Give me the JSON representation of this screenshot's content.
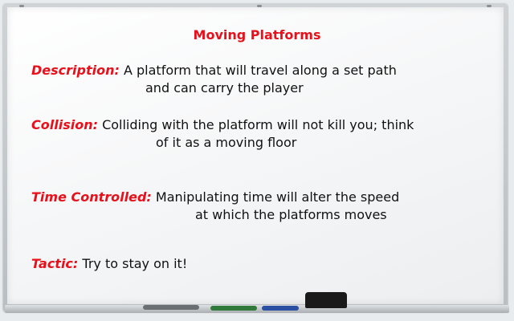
{
  "board": {
    "title": "Moving Platforms",
    "entries": [
      {
        "label": "Description:",
        "line1": "A platform that will travel along a set path",
        "line2": "and can carry the player"
      },
      {
        "label": "Collision:",
        "line1": "Colliding with the platform will not kill you; think",
        "line2": "of it as a moving floor"
      },
      {
        "label": "Time Controlled:",
        "line1": "Manipulating time will alter the speed",
        "line2": "at which the platforms moves"
      },
      {
        "label": "Tactic:",
        "line1": "Try to stay on it!"
      }
    ]
  },
  "colors": {
    "heading": "#e8101a",
    "body_text": "#111111",
    "board_surface": "#f6f7f8",
    "frame": "#c4c8cb"
  },
  "tray_items": [
    "eraser-icon",
    "marker-icon",
    "marker-icon",
    "marker-icon"
  ]
}
